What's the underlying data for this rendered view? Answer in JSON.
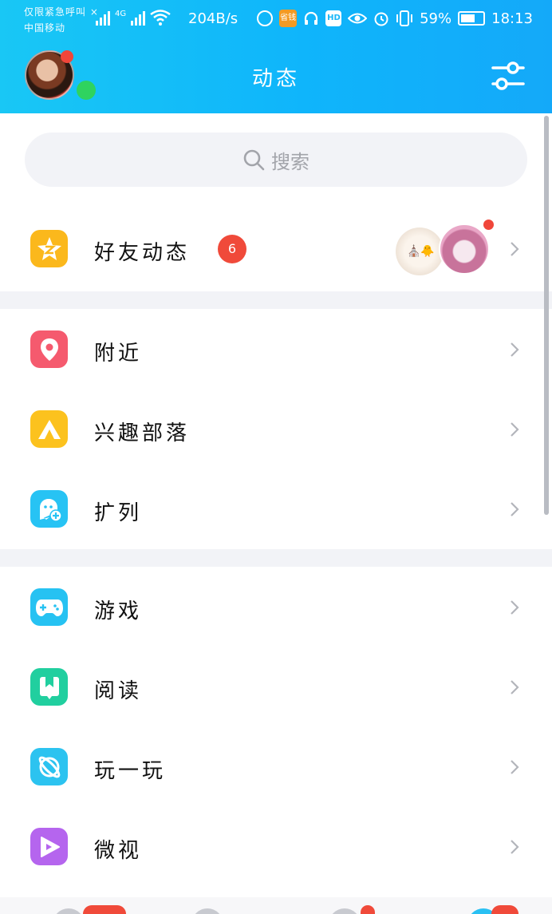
{
  "status_bar": {
    "carrier_line1": "仅限紧急呼叫 ×",
    "carrier_line2": "中国移动",
    "network": "4G",
    "net_speed": "204B/s",
    "app_badge": "省钱",
    "hd": "HD",
    "battery": "59%",
    "time": "18:13"
  },
  "header": {
    "title": "动态"
  },
  "search": {
    "placeholder": "搜索"
  },
  "sections": [
    {
      "items": [
        {
          "label": "好友动态",
          "badge": "6",
          "icon": "qzone-star-icon",
          "color": "#fbb81c"
        }
      ]
    },
    {
      "items": [
        {
          "label": "附近",
          "icon": "location-pin-icon",
          "color": "#f55a6e"
        },
        {
          "label": "兴趣部落",
          "icon": "tent-icon",
          "color": "#fcc21e"
        },
        {
          "label": "扩列",
          "icon": "add-friend-ghost-icon",
          "color": "#27c3f4"
        }
      ]
    },
    {
      "items": [
        {
          "label": "游戏",
          "icon": "gamepad-icon",
          "color": "#26c2f2"
        },
        {
          "label": "阅读",
          "icon": "bookmark-book-icon",
          "color": "#21cf9f"
        },
        {
          "label": "玩一玩",
          "icon": "planet-icon",
          "color": "#2cc3f0"
        },
        {
          "label": "微视",
          "icon": "play-video-icon",
          "color": "#b565ee"
        }
      ]
    }
  ],
  "colors": {
    "header_gradient_start": "#19c7f5",
    "header_gradient_end": "#14a9f9",
    "badge": "#f04a3a",
    "online": "#2fd35f",
    "section_bg": "#f2f3f7"
  }
}
